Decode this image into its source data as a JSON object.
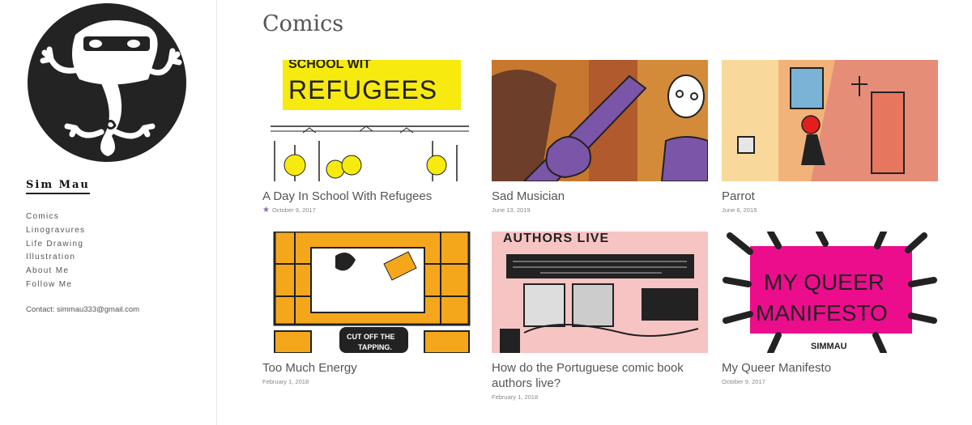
{
  "site": {
    "title": "Sim Mau",
    "contact": "Contact: simmau333@gmail.com"
  },
  "nav": [
    {
      "label": "Comics"
    },
    {
      "label": "Linogravures"
    },
    {
      "label": "Life Drawing"
    },
    {
      "label": "Illustration"
    },
    {
      "label": "About Me"
    },
    {
      "label": "Follow Me"
    }
  ],
  "page": {
    "title": "Comics"
  },
  "posts": [
    {
      "title": "A Day In School With Refugees",
      "date": "October 9, 2017",
      "thumb_text_1": "SCHOOL WIT",
      "thumb_text_2": "REFUGEES"
    },
    {
      "title": "Sad Musician",
      "date": "June 13, 2019"
    },
    {
      "title": "Parrot",
      "date": "June 6, 2019"
    },
    {
      "title": "Too Much Energy",
      "date": "February 1, 2018",
      "thumb_text_1": "CUT OFF THE",
      "thumb_text_2": "TAPPING."
    },
    {
      "title": "How do the Portuguese comic book authors live?",
      "date": "February 1, 2018",
      "thumb_text_1": "AUTHORS LIVE"
    },
    {
      "title": "My Queer Manifesto",
      "date": "October 9, 2017",
      "thumb_text_1": "MY QUEER",
      "thumb_text_2": "MANIFESTO",
      "thumb_text_3": "SIMMAU"
    }
  ],
  "colors": {
    "accent_star": "#8e6aa8",
    "yellow": "#f7ea0f",
    "orange": "#f5a71c",
    "purple": "#7b55a8",
    "pink": "#ec0d8c"
  }
}
